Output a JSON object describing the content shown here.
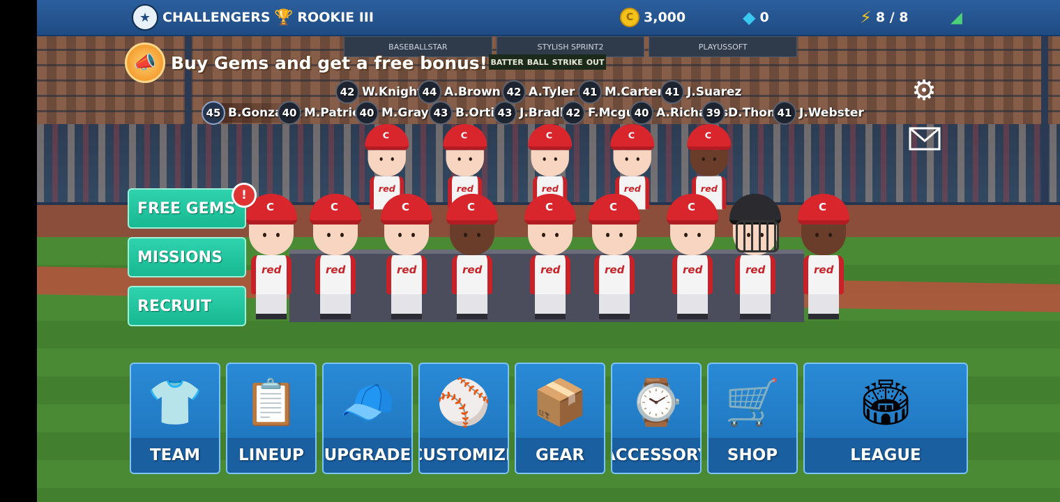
{
  "topbar": {
    "team_name": "CHALLENGERS",
    "rank": "ROOKIE III",
    "coins": "3,000",
    "gems": "0",
    "energy": "8 / 8"
  },
  "promo": {
    "text": "Buy Gems and get a free bonus!"
  },
  "roster_row1": [
    {
      "num": "42",
      "name": "W.Knight"
    },
    {
      "num": "44",
      "name": "A.Brown"
    },
    {
      "num": "42",
      "name": "A.Tyler"
    },
    {
      "num": "41",
      "name": "M.Carter"
    },
    {
      "num": "41",
      "name": "J.Suarez"
    }
  ],
  "roster_row2": [
    {
      "num": "45",
      "name": "B.Gonzalez"
    },
    {
      "num": "40",
      "name": "M.Patrick"
    },
    {
      "num": "40",
      "name": "M.Gray"
    },
    {
      "num": "43",
      "name": "B.Ortiz"
    },
    {
      "num": "43",
      "name": "J.Bradley"
    },
    {
      "num": "42",
      "name": "F.Mcguire"
    },
    {
      "num": "40",
      "name": "A.Richards"
    },
    {
      "num": "39",
      "name": "D.Thomas"
    },
    {
      "num": "41",
      "name": "J.Webster"
    }
  ],
  "side_buttons": {
    "free_gems": "FREE GEMS",
    "missions": "MISSIONS",
    "recruit": "RECRUIT",
    "alert": "!"
  },
  "team_cap_letter": "C",
  "jersey_text": "red",
  "background_signs": {
    "sign1": "BASEBALLSTAR",
    "sign2": "STYLISH SPRINT2",
    "sign3": "PLAYUSSOFT"
  },
  "scoreboard": [
    "BATTER",
    "BALL",
    "STRIKE",
    "OUT"
  ],
  "menu": {
    "team": "TEAM",
    "lineup": "LINEUP",
    "upgrade": "UPGRADE",
    "customize": "CUSTOMIZE",
    "gear": "GEAR",
    "accessory": "ACCESSORY",
    "shop": "SHOP",
    "league": "LEAGUE"
  },
  "icons": {
    "team_logo": "team-logo-icon",
    "trophy": "trophy-icon",
    "coin": "coin-icon",
    "gem": "gem-icon",
    "energy": "lightning-icon",
    "signal": "signal-icon",
    "settings": "gear-icon",
    "mail": "mail-icon",
    "promo": "megaphone-icon"
  },
  "colors": {
    "topbar": "#1f4b83",
    "side_button": "#1fc49c",
    "menu_tile": "#2a8ad6",
    "cap": "#d8262c"
  }
}
